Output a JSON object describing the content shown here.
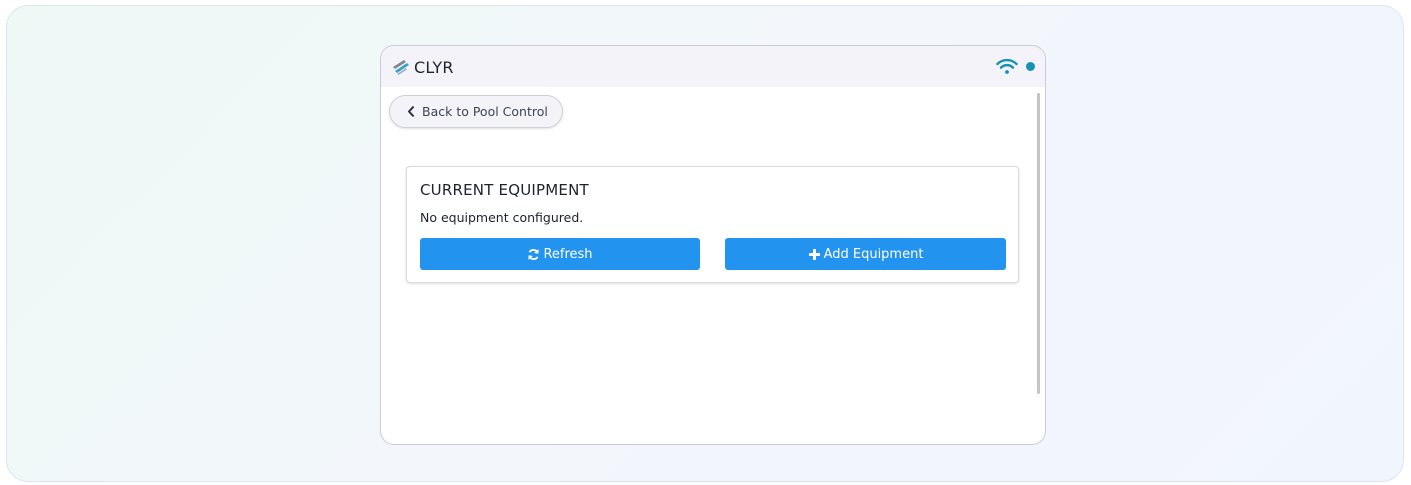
{
  "header": {
    "brand": "CLYR",
    "icons": [
      "clyr-logo-icon",
      "wifi-icon",
      "status-dot-icon"
    ],
    "status_color": "#1493b5"
  },
  "nav": {
    "back_label": "Back to Pool Control",
    "back_icon": "chevron-left-icon"
  },
  "equipment": {
    "title": "CURRENT EQUIPMENT",
    "empty_message": "No equipment configured.",
    "refresh_label": "Refresh",
    "refresh_icon": "refresh-icon",
    "add_label": "Add Equipment",
    "add_icon": "plus-icon"
  },
  "colors": {
    "primary_button": "#2293ef",
    "accent": "#1493b5"
  }
}
